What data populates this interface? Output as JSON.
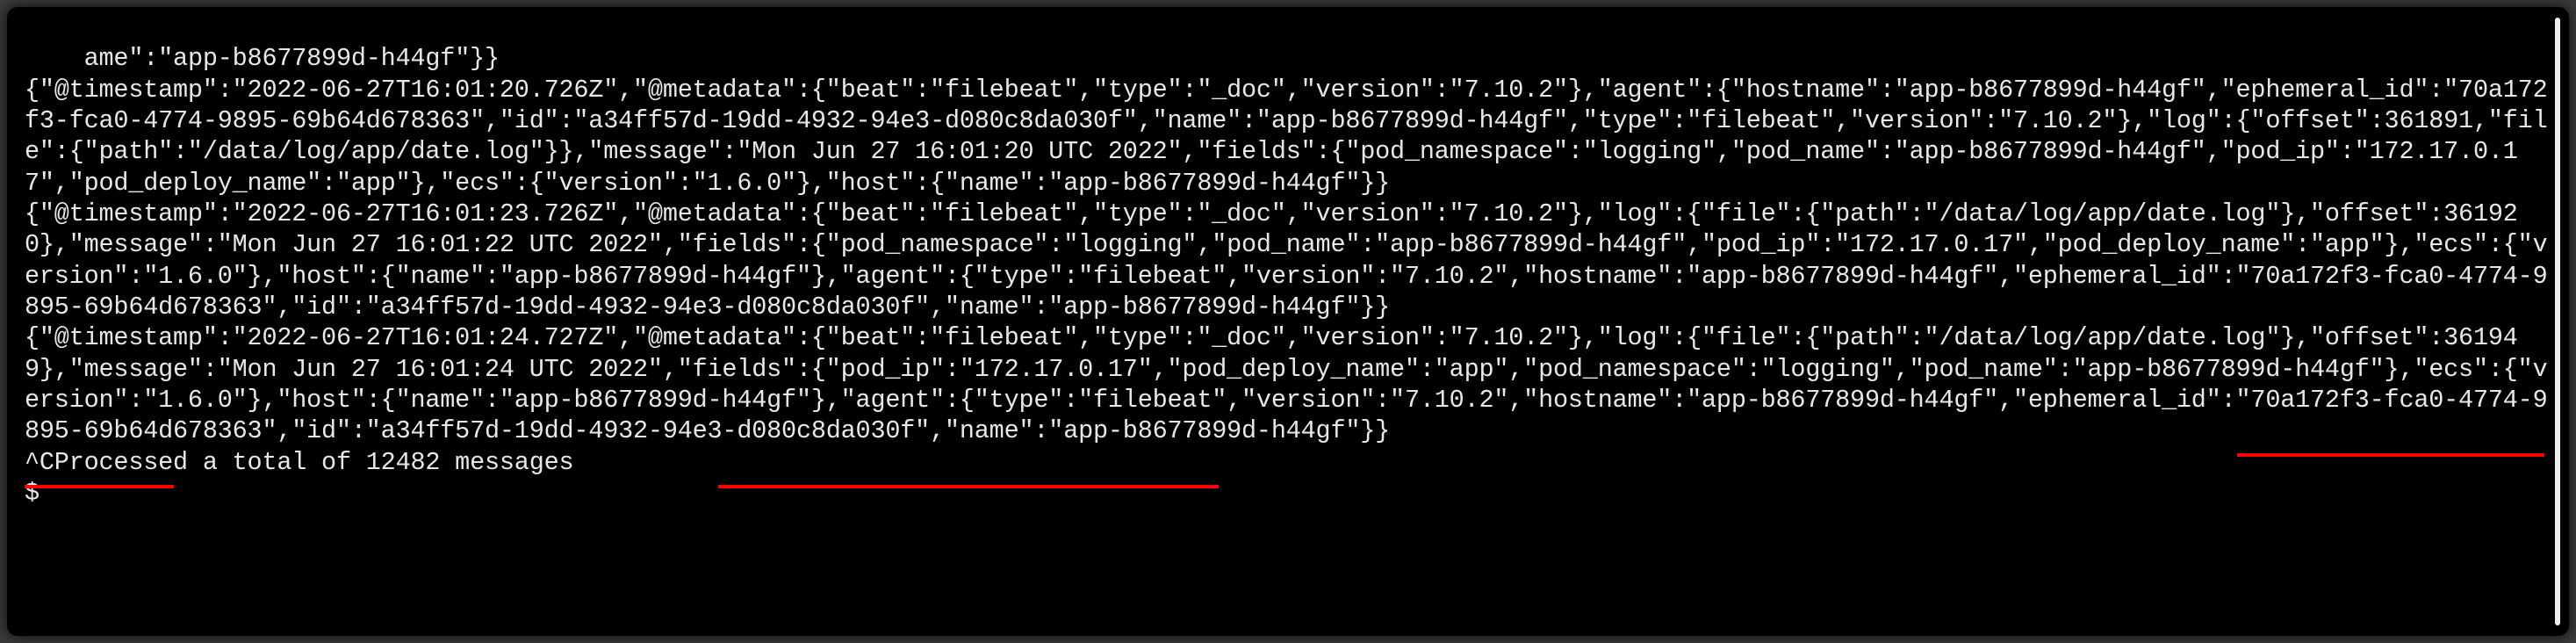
{
  "terminal": {
    "lines": [
      "ame\":\"app-b8677899d-h44gf\"}}",
      "{\"@timestamp\":\"2022-06-27T16:01:20.726Z\",\"@metadata\":{\"beat\":\"filebeat\",\"type\":\"_doc\",\"version\":\"7.10.2\"},\"agent\":{\"hostname\":\"app-b8677899d-h44gf\",\"ephemeral_id\":\"70a172f3-fca0-4774-9895-69b64d678363\",\"id\":\"a34ff57d-19dd-4932-94e3-d080c8da030f\",\"name\":\"app-b8677899d-h44gf\",\"type\":\"filebeat\",\"version\":\"7.10.2\"},\"log\":{\"offset\":361891,\"file\":{\"path\":\"/data/log/app/date.log\"}},\"message\":\"Mon Jun 27 16:01:20 UTC 2022\",\"fields\":{\"pod_namespace\":\"logging\",\"pod_name\":\"app-b8677899d-h44gf\",\"pod_ip\":\"172.17.0.17\",\"pod_deploy_name\":\"app\"},\"ecs\":{\"version\":\"1.6.0\"},\"host\":{\"name\":\"app-b8677899d-h44gf\"}}",
      "{\"@timestamp\":\"2022-06-27T16:01:23.726Z\",\"@metadata\":{\"beat\":\"filebeat\",\"type\":\"_doc\",\"version\":\"7.10.2\"},\"log\":{\"file\":{\"path\":\"/data/log/app/date.log\"},\"offset\":361920},\"message\":\"Mon Jun 27 16:01:22 UTC 2022\",\"fields\":{\"pod_namespace\":\"logging\",\"pod_name\":\"app-b8677899d-h44gf\",\"pod_ip\":\"172.17.0.17\",\"pod_deploy_name\":\"app\"},\"ecs\":{\"version\":\"1.6.0\"},\"host\":{\"name\":\"app-b8677899d-h44gf\"},\"agent\":{\"type\":\"filebeat\",\"version\":\"7.10.2\",\"hostname\":\"app-b8677899d-h44gf\",\"ephemeral_id\":\"70a172f3-fca0-4774-9895-69b64d678363\",\"id\":\"a34ff57d-19dd-4932-94e3-d080c8da030f\",\"name\":\"app-b8677899d-h44gf\"}}",
      "{\"@timestamp\":\"2022-06-27T16:01:24.727Z\",\"@metadata\":{\"beat\":\"filebeat\",\"type\":\"_doc\",\"version\":\"7.10.2\"},\"log\":{\"file\":{\"path\":\"/data/log/app/date.log\"},\"offset\":361949},\"message\":\"Mon Jun 27 16:01:24 UTC 2022\",\"fields\":{\"pod_ip\":\"172.17.0.17\",\"pod_deploy_name\":\"app\",\"pod_namespace\":\"logging\",\"pod_name\":\"app-b8677899d-h44gf\"},\"ecs\":{\"version\":\"1.6.0\"},\"host\":{\"name\":\"app-b8677899d-h44gf\"},\"agent\":{\"type\":\"filebeat\",\"version\":\"7.10.2\",\"hostname\":\"app-b8677899d-h44gf\",\"ephemeral_id\":\"70a172f3-fca0-4774-9895-69b64d678363\",\"id\":\"a34ff57d-19dd-4932-94e3-d080c8da030f\",\"name\":\"app-b8677899d-h44gf\"}}",
      "^CProcessed a total of 12482 messages",
      "$"
    ]
  }
}
